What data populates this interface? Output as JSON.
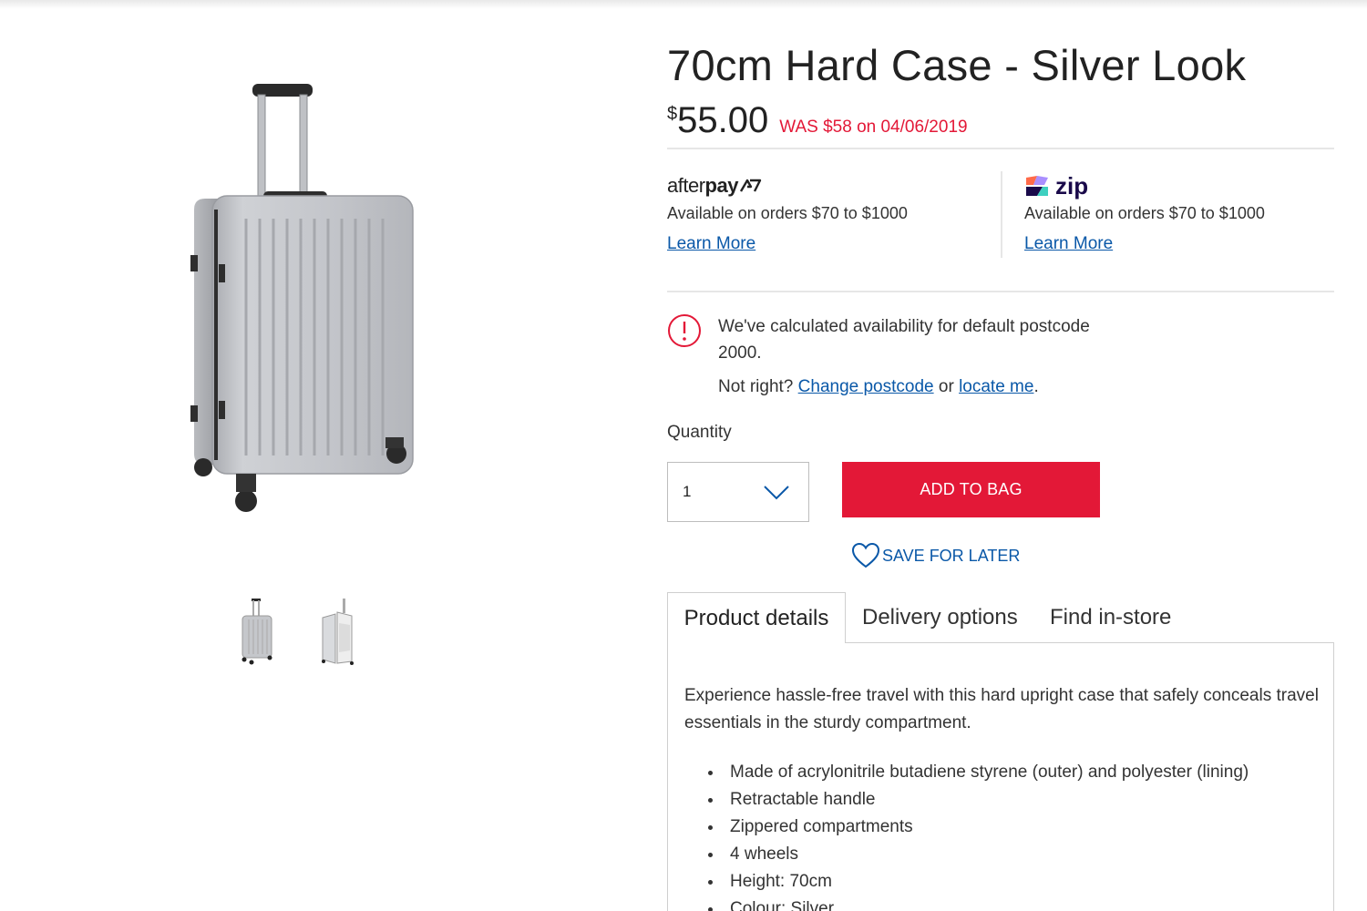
{
  "product": {
    "title": "70cm Hard Case - Silver Look",
    "price_symbol": "$",
    "price": "55.00",
    "was_text": "WAS $58 on 04/06/2019"
  },
  "afterpay": {
    "logo_light": "after",
    "logo_bold": "pay",
    "text": "Available on orders $70 to $1000",
    "link": "Learn More"
  },
  "zip": {
    "logo_text": "zip",
    "text": "Available on orders $70 to $1000",
    "link": "Learn More"
  },
  "availability": {
    "message": "We've calculated availability for default postcode 2000.",
    "not_right": "Not right?",
    "change_postcode": "Change postcode",
    "or": "or",
    "locate_me": "locate me",
    "period": "."
  },
  "quantity": {
    "label": "Quantity",
    "value": "1"
  },
  "actions": {
    "add_to_bag": "ADD TO BAG",
    "save_for_later": "SAVE FOR LATER"
  },
  "tabs": [
    {
      "label": "Product details",
      "active": true
    },
    {
      "label": "Delivery options",
      "active": false
    },
    {
      "label": "Find in-store",
      "active": false
    }
  ],
  "details": {
    "description": "Experience hassle-free travel with this hard upright case that safely conceals travel essentials in the sturdy compartment.",
    "features": [
      "Made of acrylonitrile butadiene styrene (outer) and polyester (lining)",
      "Retractable handle",
      "Zippered compartments",
      "4 wheels",
      "Height: 70cm",
      "Colour: Silver"
    ]
  },
  "colors": {
    "accent_red": "#e31837",
    "link_blue": "#0a58a8"
  }
}
